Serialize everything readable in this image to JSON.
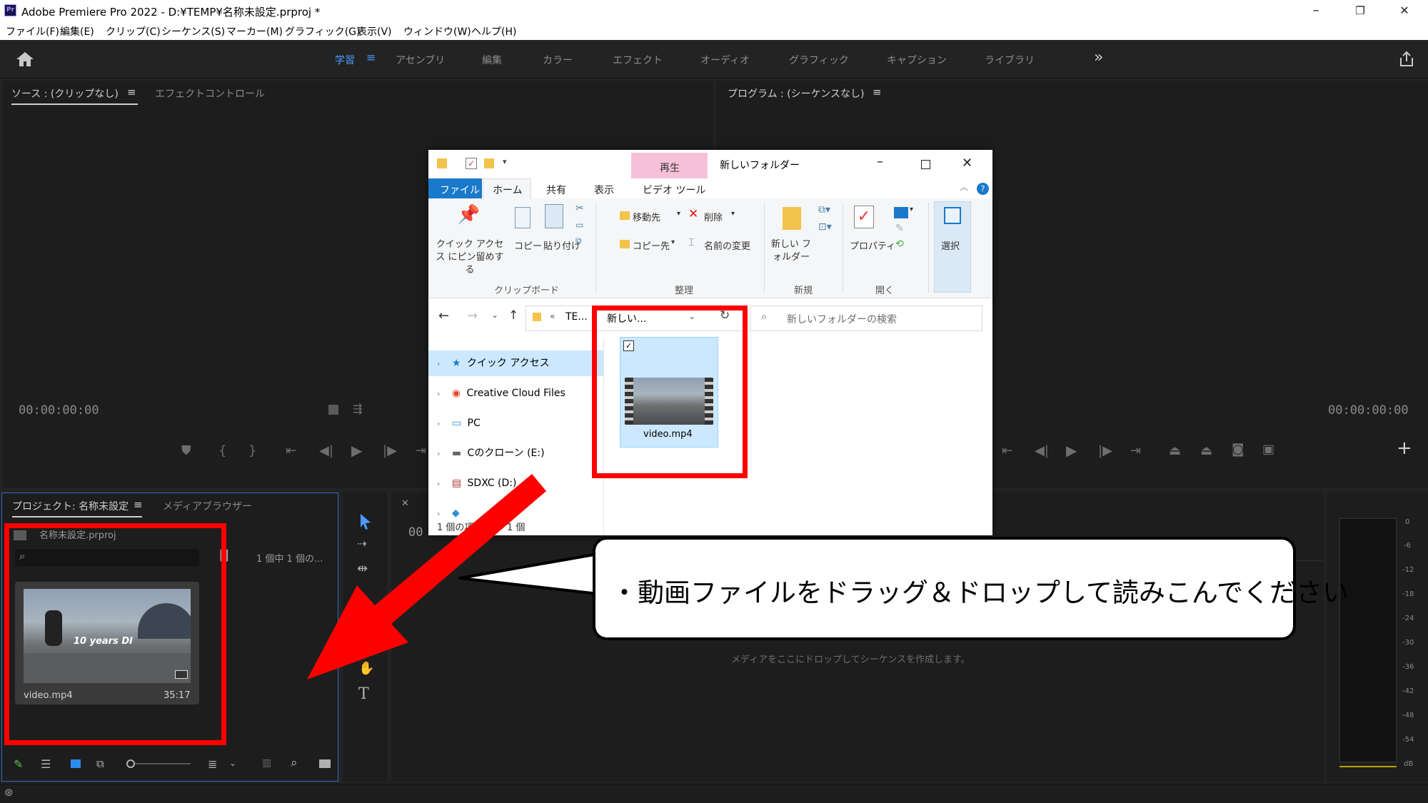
{
  "titlebar": {
    "logo": "Pr",
    "title": "Adobe Premiere Pro 2022 - D:¥TEMP¥名称未設定.prproj *",
    "minimize": "–",
    "restore": "❐",
    "close": "✕"
  },
  "menubar": [
    "ファイル(F)",
    "編集(E)",
    "クリップ(C)",
    "シーケンス(S)",
    "マーカー(M)",
    "グラフィック(G)",
    "表示(V)",
    "ウィンドウ(W)",
    "ヘルプ(H)"
  ],
  "workspaces": {
    "items": [
      "学習",
      "アセンブリ",
      "編集",
      "カラー",
      "エフェクト",
      "オーディオ",
      "グラフィック",
      "キャプション",
      "ライブラリ"
    ],
    "active": "学習",
    "more": "»"
  },
  "source_panel": {
    "tab_source": "ソース : (クリップなし)",
    "tab_effect_controls": "エフェクトコントロール",
    "timecode": "00:00:00:00"
  },
  "program_panel": {
    "tab": "プログラム : (シーケンスなし)",
    "timecode": "00:00:00:00"
  },
  "project_panel": {
    "tab_project": "プロジェクト: 名称未設定",
    "tab_media_browser": "メディアブラウザー",
    "project_file": "名称未設定.prproj",
    "item_count": "1 個中 1 個の...",
    "clip_name": "video.mp4",
    "clip_duration": "35:17"
  },
  "timeline_panel": {
    "placeholder": "メディアをここにドロップしてシーケンスを作成します。",
    "timecode_partial": "00"
  },
  "audio_meter": {
    "scale": [
      "0",
      "-6",
      "-12",
      "-18",
      "-24",
      "-30",
      "-36",
      "-42",
      "-48",
      "-54",
      "dB"
    ]
  },
  "explorer": {
    "context_tab": "再生",
    "title": "新しいフォルダー",
    "tabs": [
      "ファイル",
      "ホーム",
      "共有",
      "表示",
      "ビデオ ツール"
    ],
    "ribbon": {
      "pin": "クイック アクセス にピン留めする",
      "copy": "コピー",
      "paste": "貼り付け",
      "clipboard": "クリップボード",
      "move_to": "移動先",
      "delete": "削除",
      "copy_to": "コピー先",
      "rename": "名前の変更",
      "organize": "整理",
      "new_folder": "新しい フォルダー",
      "new": "新規",
      "properties": "プロパティ",
      "open": "開く",
      "select": "選択"
    },
    "address": {
      "path_parent": "TE...",
      "path_current": "新しい...",
      "search_placeholder": "新しいフォルダーの検索"
    },
    "nav_items": [
      "クイック アクセス",
      "Creative Cloud Files",
      "PC",
      "Cのクローン (E:)",
      "SDXC (D:)",
      ""
    ],
    "status": {
      "count": "1 個の項目",
      "selected": "1 個"
    },
    "file": {
      "name": "video.mp4"
    }
  },
  "callout": {
    "text": "・動画ファイルをドラッグ＆ドロップして読みこんでください"
  },
  "colors": {
    "accent_blue": "#4a9bff",
    "annotation_red": "#ff0000",
    "explorer_file_tab": "#1979ca",
    "context_tab_pink": "#f6c1d8"
  }
}
